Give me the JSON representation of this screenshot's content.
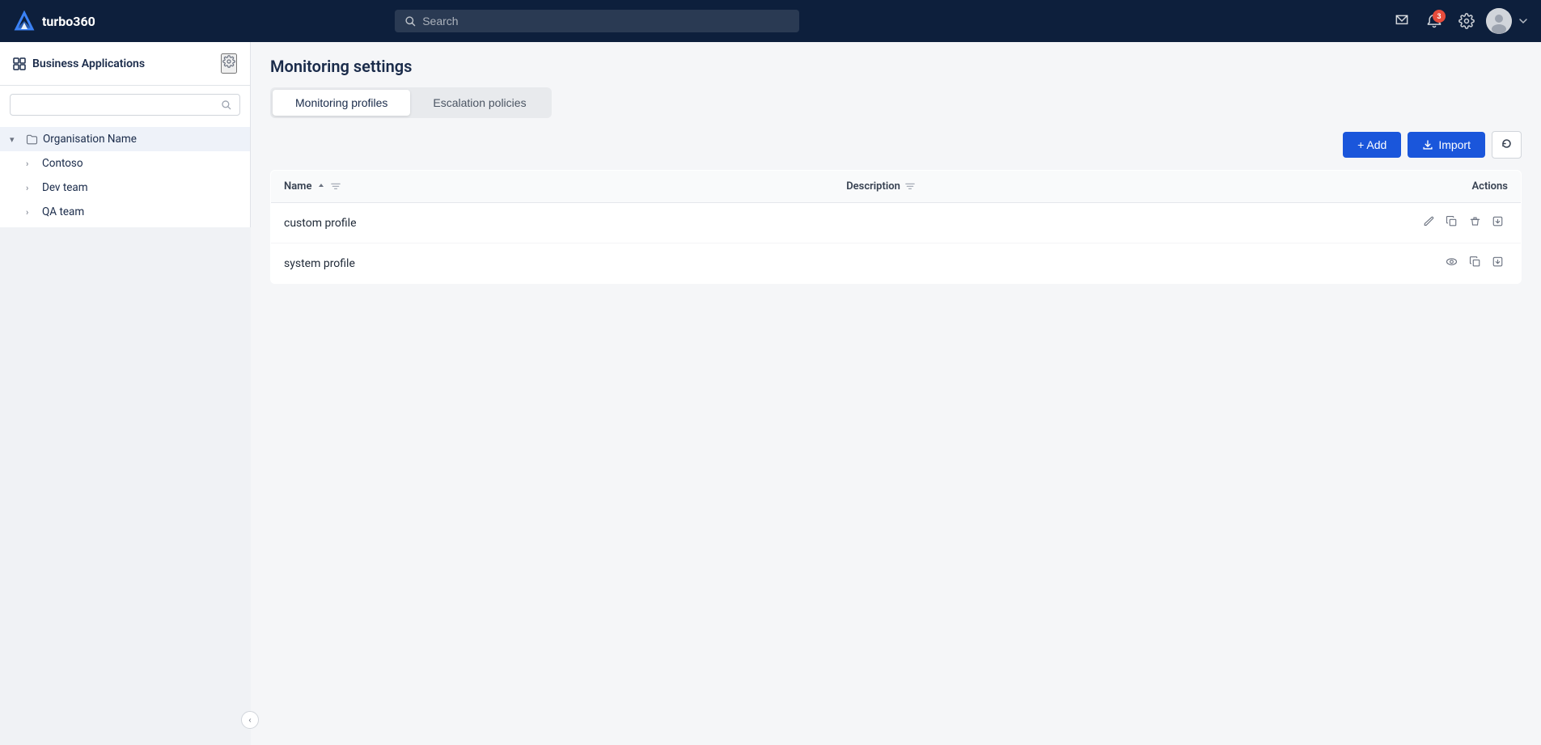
{
  "app": {
    "name": "turbo360"
  },
  "topnav": {
    "search_placeholder": "Search",
    "notification_badge": "3",
    "message_badge": ""
  },
  "sidebar": {
    "title": "Business Applications",
    "search_placeholder": "",
    "tree": [
      {
        "id": "org",
        "label": "Organisation Name",
        "level": 0,
        "expanded": true,
        "type": "folder"
      },
      {
        "id": "contoso",
        "label": "Contoso",
        "level": 1,
        "expanded": false,
        "type": "node"
      },
      {
        "id": "devteam",
        "label": "Dev team",
        "level": 1,
        "expanded": false,
        "type": "node"
      },
      {
        "id": "qateam",
        "label": "QA team",
        "level": 1,
        "expanded": false,
        "type": "node"
      }
    ],
    "collapse_btn": "<"
  },
  "main": {
    "title": "Monitoring settings",
    "tabs": [
      {
        "id": "profiles",
        "label": "Monitoring profiles",
        "active": true
      },
      {
        "id": "escalation",
        "label": "Escalation policies",
        "active": false
      }
    ],
    "toolbar": {
      "add_label": "+ Add",
      "import_label": "Import",
      "refresh_label": "↻"
    },
    "table": {
      "columns": [
        {
          "id": "name",
          "label": "Name",
          "sortable": true,
          "filterable": true
        },
        {
          "id": "description",
          "label": "Description",
          "sortable": false,
          "filterable": true
        },
        {
          "id": "actions",
          "label": "Actions",
          "sortable": false,
          "filterable": false
        }
      ],
      "rows": [
        {
          "id": "custom-profile",
          "name": "custom profile",
          "description": "",
          "is_system": false
        },
        {
          "id": "system-profile",
          "name": "system profile",
          "description": "",
          "is_system": true
        }
      ]
    }
  }
}
